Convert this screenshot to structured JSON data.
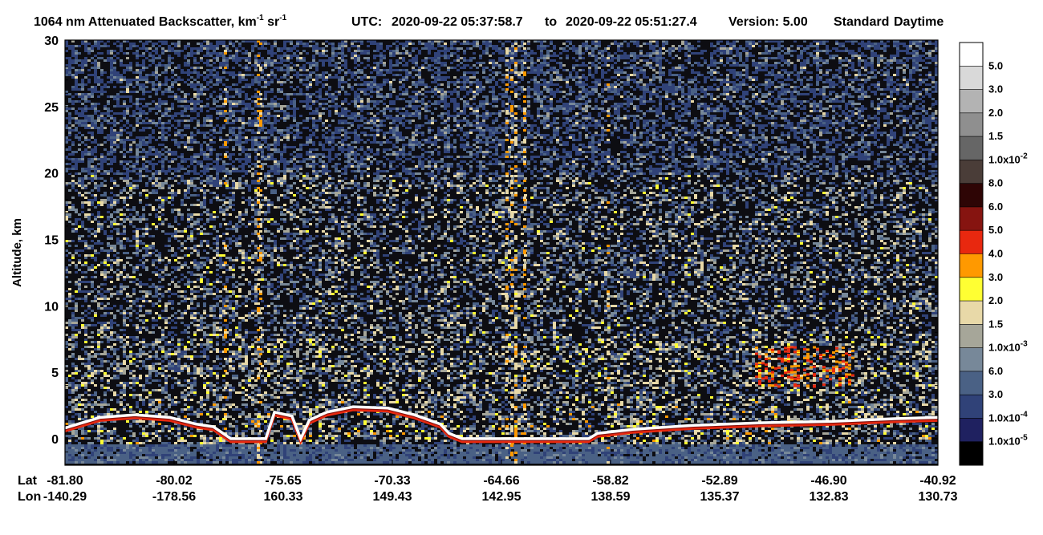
{
  "chart_data": {
    "type": "heatmap",
    "title": {
      "main": "1064 nm Attenuated Backscatter, km",
      "unit_sup1": "-1",
      "unit_mid": " sr",
      "unit_sup2": "-1",
      "utc_label": "UTC:",
      "utc_start": "2020-09-22 05:37:58.7",
      "utc_to": "to",
      "utc_end": "2020-09-22 05:51:27.4",
      "version": "Version: 5.00",
      "product": "Standard",
      "mode": "Daytime"
    },
    "ylabel": "Altitude, km",
    "ylim": [
      -2,
      30
    ],
    "yticks": [
      0,
      5,
      10,
      15,
      20,
      25,
      30
    ],
    "x_row_labels": [
      "Lat",
      "Lon"
    ],
    "x_ticks": [
      {
        "lat": "-81.80",
        "lon": "-140.29"
      },
      {
        "lat": "-80.02",
        "lon": "-178.56"
      },
      {
        "lat": "-75.65",
        "lon": "160.33"
      },
      {
        "lat": "-70.33",
        "lon": "149.43"
      },
      {
        "lat": "-64.66",
        "lon": "142.95"
      },
      {
        "lat": "-58.82",
        "lon": "138.59"
      },
      {
        "lat": "-52.89",
        "lon": "135.37"
      },
      {
        "lat": "-46.90",
        "lon": "132.83"
      },
      {
        "lat": "-40.92",
        "lon": "130.73"
      }
    ],
    "colorbar": {
      "colors": [
        "#ffffff",
        "#d9d9d9",
        "#b3b3b3",
        "#8f8f8f",
        "#666666",
        "#4a3d38",
        "#2e0505",
        "#861410",
        "#e8280f",
        "#ff9900",
        "#ffff33",
        "#e8d9a8",
        "#a6a699",
        "#778899",
        "#4a6185",
        "#304278",
        "#1f2160",
        "#000000"
      ],
      "labels": [
        {
          "text": "5.0"
        },
        {
          "text": "3.0"
        },
        {
          "text": "2.0"
        },
        {
          "text": "1.5"
        },
        {
          "text": "1.0x10",
          "sup": "-2"
        },
        {
          "text": "8.0"
        },
        {
          "text": "6.0"
        },
        {
          "text": "5.0"
        },
        {
          "text": "4.0"
        },
        {
          "text": "3.0"
        },
        {
          "text": "2.0"
        },
        {
          "text": "1.5"
        },
        {
          "text": "1.0x10",
          "sup": "-3"
        },
        {
          "text": "6.0"
        },
        {
          "text": "3.0"
        },
        {
          "text": "1.0x10",
          "sup": "-4"
        },
        {
          "text": "1.0x10",
          "sup": "-5"
        }
      ]
    },
    "surface_profile_km": [
      [
        0.0,
        0.8
      ],
      [
        0.04,
        1.6
      ],
      [
        0.08,
        1.8
      ],
      [
        0.12,
        1.6
      ],
      [
        0.15,
        1.1
      ],
      [
        0.17,
        0.9
      ],
      [
        0.19,
        0.0
      ],
      [
        0.23,
        0.0
      ],
      [
        0.24,
        2.0
      ],
      [
        0.26,
        1.7
      ],
      [
        0.27,
        0.0
      ],
      [
        0.28,
        1.4
      ],
      [
        0.3,
        2.0
      ],
      [
        0.33,
        2.4
      ],
      [
        0.37,
        2.3
      ],
      [
        0.4,
        1.8
      ],
      [
        0.43,
        1.1
      ],
      [
        0.44,
        0.4
      ],
      [
        0.455,
        0.0
      ],
      [
        0.58,
        0.0
      ],
      [
        0.6,
        0.0
      ],
      [
        0.61,
        0.4
      ],
      [
        0.65,
        0.7
      ],
      [
        0.72,
        1.0
      ],
      [
        0.8,
        1.2
      ],
      [
        0.88,
        1.3
      ],
      [
        0.95,
        1.5
      ],
      [
        1.0,
        1.6
      ]
    ]
  }
}
